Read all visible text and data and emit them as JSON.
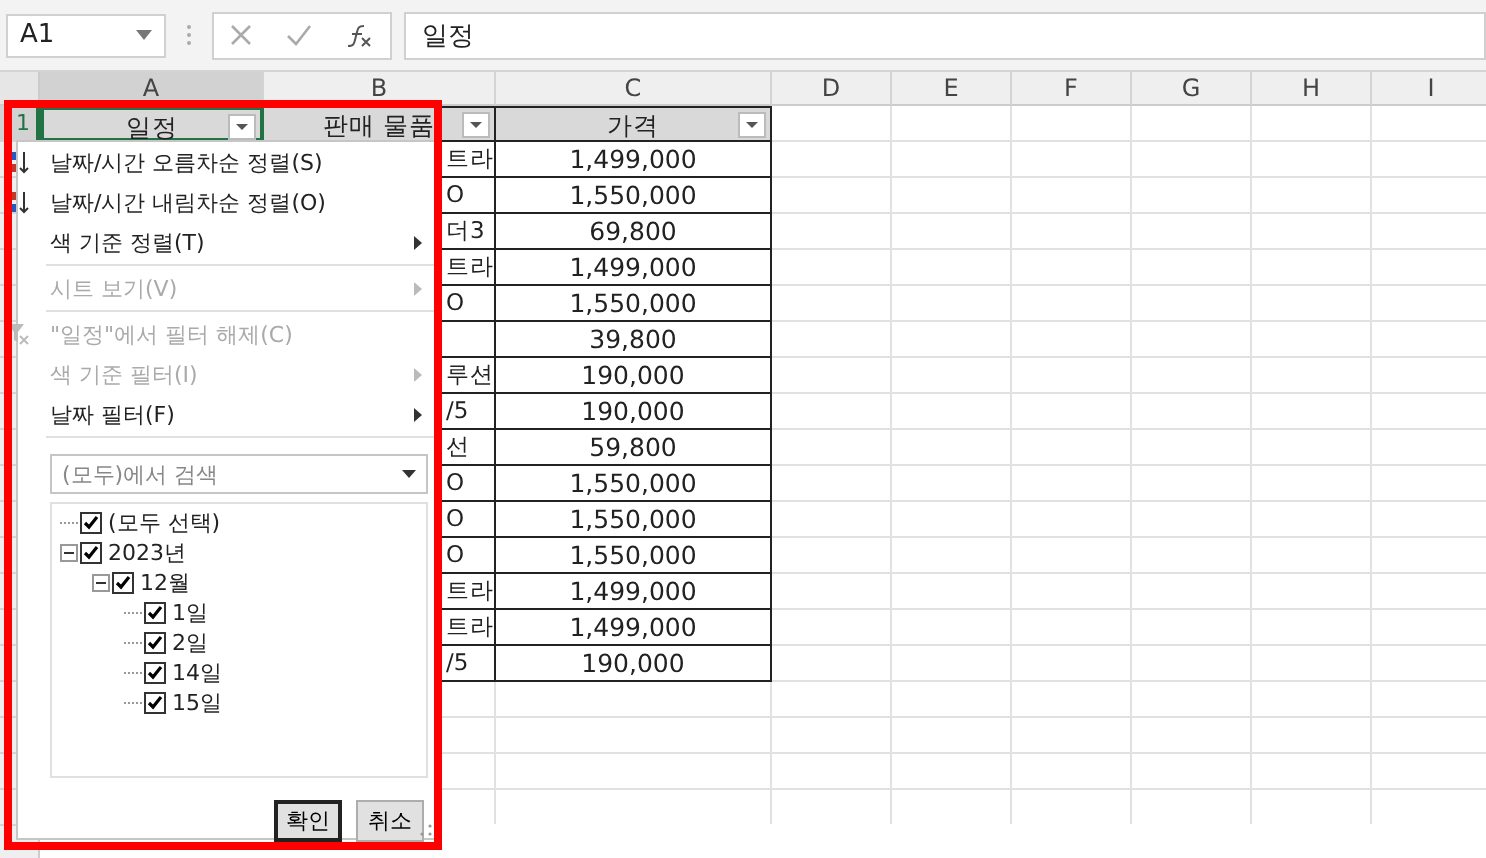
{
  "formula_bar": {
    "name_box": "A1",
    "formula": "일정"
  },
  "columns": [
    {
      "label": "A",
      "selected": true
    },
    {
      "label": "B",
      "selected": false
    },
    {
      "label": "C",
      "selected": false
    },
    {
      "label": "D",
      "selected": false
    },
    {
      "label": "E",
      "selected": false
    },
    {
      "label": "F",
      "selected": false
    },
    {
      "label": "G",
      "selected": false
    },
    {
      "label": "H",
      "selected": false
    },
    {
      "label": "I",
      "selected": false
    }
  ],
  "header_row": {
    "row_number": "1",
    "cells": [
      "일정",
      "판매 물품",
      "가격"
    ]
  },
  "rows": [
    {
      "product": "트라",
      "price": "1,499,000"
    },
    {
      "product": "O",
      "price": "1,550,000"
    },
    {
      "product": "더3",
      "price": "69,800"
    },
    {
      "product": "트라",
      "price": "1,499,000"
    },
    {
      "product": "O",
      "price": "1,550,000"
    },
    {
      "price": "39,800"
    },
    {
      "product": "루션",
      "price": "190,000"
    },
    {
      "product": "/5",
      "price": "190,000"
    },
    {
      "product": "선",
      "price": "59,800"
    },
    {
      "product": "O",
      "price": "1,550,000"
    },
    {
      "product": "O",
      "price": "1,550,000"
    },
    {
      "product": "O",
      "price": "1,550,000"
    },
    {
      "product": "트라",
      "price": "1,499,000"
    },
    {
      "product": "트라",
      "price": "1,499,000"
    },
    {
      "product": "/5",
      "price": "190,000"
    }
  ],
  "filter_menu": {
    "items": [
      {
        "kind": "sort-asc",
        "label": "날짜/시간 오름차순 정렬(S)",
        "disabled": false,
        "submenu": false
      },
      {
        "kind": "sort-desc",
        "label": "날짜/시간 내림차순 정렬(O)",
        "disabled": false,
        "submenu": false
      },
      {
        "kind": "plain",
        "label": "색 기준 정렬(T)",
        "disabled": false,
        "submenu": true
      },
      {
        "kind": "separator"
      },
      {
        "kind": "plain",
        "label": "시트 보기(V)",
        "disabled": true,
        "submenu": true
      },
      {
        "kind": "separator"
      },
      {
        "kind": "clear-filter",
        "label": "\"일정\"에서 필터 해제(C)",
        "disabled": true,
        "submenu": false
      },
      {
        "kind": "plain",
        "label": "색 기준 필터(I)",
        "disabled": true,
        "submenu": true
      },
      {
        "kind": "plain",
        "label": "날짜 필터(F)",
        "disabled": false,
        "submenu": true
      },
      {
        "kind": "separator"
      }
    ],
    "search": {
      "placeholder": "(모두)에서 검색"
    },
    "tree": [
      {
        "label": "(모두 선택)",
        "checked": true
      },
      {
        "label": "2023년",
        "checked": true,
        "expanded": true,
        "children": [
          {
            "label": "12월",
            "checked": true,
            "expanded": true,
            "children": [
              {
                "label": "1일",
                "checked": true
              },
              {
                "label": "2일",
                "checked": true
              },
              {
                "label": "14일",
                "checked": true
              },
              {
                "label": "15일",
                "checked": true
              }
            ]
          }
        ]
      }
    ],
    "buttons": [
      {
        "label": "확인",
        "default": true
      },
      {
        "label": "취소",
        "default": false
      }
    ]
  }
}
